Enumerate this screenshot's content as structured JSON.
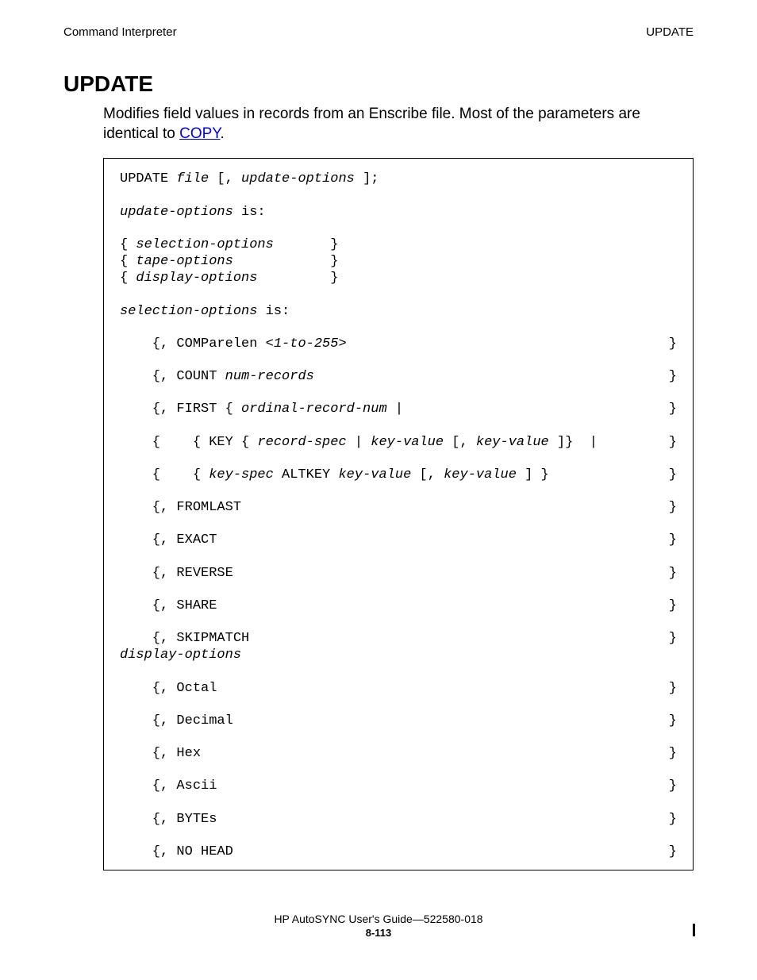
{
  "header": {
    "left": "Command Interpreter",
    "right": "UPDATE"
  },
  "title": "UPDATE",
  "intro": {
    "text_before_link": "Modifies field values in records from an Enscribe file. Most of the parameters are identical to ",
    "link_text": "COPY",
    "text_after_link": "."
  },
  "syntax": {
    "line1_pre": "UPDATE ",
    "line1_file": "file",
    "line1_mid": " [, ",
    "line1_opts": "update-options",
    "line1_post": " ];",
    "uo_label": "update-options",
    "uo_is": " is:",
    "grp1_a": "{ ",
    "grp1_a_it": "selection-options",
    "grp1_a_close": "       }",
    "grp1_b": "{ ",
    "grp1_b_it": "tape-options",
    "grp1_b_close": "            }",
    "grp1_c": "{ ",
    "grp1_c_it": "display-options",
    "grp1_c_close": "         }",
    "so_label": "selection-options",
    "so_is": " is:",
    "opt_comparelen_l": "    {, COMParelen ",
    "opt_comparelen_it": "<1-to-255>",
    "opt_brace_r": "}",
    "opt_count_l": "    {, COUNT ",
    "opt_count_it": "num-records",
    "opt_first_l": "    {, FIRST { ",
    "opt_first_it": "ordinal-record-num",
    "opt_first_post": " |",
    "opt_key_l": "    {    { KEY { ",
    "opt_key_it1": "record-spec",
    "opt_key_mid1": " | ",
    "opt_key_it2": "key-value",
    "opt_key_mid2": " [, ",
    "opt_key_it3": "key-value",
    "opt_key_post": " ]}  |",
    "opt_altkey_l": "    {    { ",
    "opt_altkey_it1": "key-spec",
    "opt_altkey_mid1": " ALTKEY ",
    "opt_altkey_it2": "key-value",
    "opt_altkey_mid2": " [, ",
    "opt_altkey_it3": "key-value",
    "opt_altkey_post": " ] }",
    "opt_fromlast": "    {, FROMLAST",
    "opt_exact": "    {, EXACT",
    "opt_reverse": "    {, REVERSE",
    "opt_share": "    {, SHARE",
    "opt_skipmatch": "    {, SKIPMATCH",
    "do_label": "display-options",
    "opt_octal": "    {, Octal",
    "opt_decimal": "    {, Decimal",
    "opt_hex": "    {, Hex",
    "opt_ascii": "    {, Ascii",
    "opt_bytes": "    {, BYTEs",
    "opt_nohead": "    {, NO HEAD"
  },
  "footer": {
    "line1": "HP AutoSYNC User's Guide—522580-018",
    "page_num": "8-113"
  }
}
